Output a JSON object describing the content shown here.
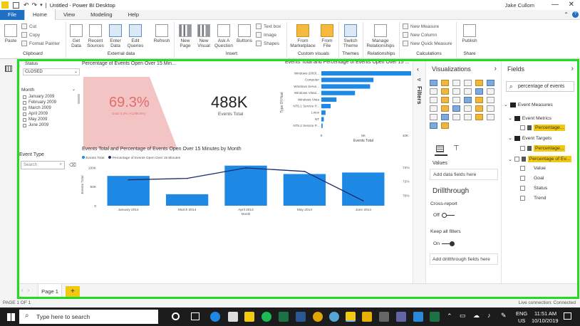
{
  "window": {
    "title": "Untitled - Power BI Desktop",
    "user": "Jake Cullom",
    "minimize": "—",
    "close": "✕"
  },
  "menu": {
    "file": "File",
    "tabs": [
      "Home",
      "View",
      "Modeling",
      "Help"
    ],
    "help_icon": "?"
  },
  "ribbon": {
    "cut": "Cut",
    "copy": "Copy",
    "format_painter": "Format Painter",
    "paste": "Paste",
    "get_data": "Get Data",
    "recent_sources": "Recent Sources",
    "enter_data": "Enter Data",
    "edit_queries": "Edit Queries",
    "refresh": "Refresh",
    "new_page": "New Page",
    "new_visual": "New Visual",
    "ask_a_question": "Ask A Question",
    "buttons": "Buttons",
    "text_box": "Text box",
    "image": "Image",
    "shapes": "Shapes",
    "from_marketplace": "From Marketplace",
    "from_file": "From File",
    "switch_theme": "Switch Theme",
    "manage_relationships": "Manage Relationships",
    "new_measure": "New Measure",
    "new_column": "New Column",
    "new_quick_measure": "New Quick Measure",
    "publish": "Publish",
    "groups": {
      "clipboard": "Clipboard",
      "external_data": "External data",
      "insert": "Insert",
      "custom_visuals": "Custom visuals",
      "themes": "Themes",
      "relationships": "Relationships",
      "calculations": "Calculations",
      "share": "Share"
    }
  },
  "report": {
    "status_slicer": {
      "label": "Status",
      "value": "CLOSED"
    },
    "month_slicer": {
      "label": "Month",
      "items": [
        "January 2009",
        "February 2009",
        "March 2009",
        "April 2009",
        "May 2009",
        "June 2009"
      ]
    },
    "event_type_slicer": {
      "label": "Event Type",
      "search_placeholder": "Search"
    },
    "gauge": {
      "title": "Percentage of Events Open Over 15 Min...",
      "value": "69.3%",
      "goal": "Goal: 5.0% (+1286.5%)",
      "fill": 0.693
    },
    "card": {
      "value": "488K",
      "label": "Events Total"
    },
    "bar_chart": {
      "title": "Events Total and Percentage of Events Open Over 15 ...",
      "ylabel": "Type Of Host",
      "xlabel": "Events Total",
      "xticks": [
        "0",
        "5K",
        "10K"
      ]
    },
    "combo_chart": {
      "title": "Events Total and Percentage of Events Open Over 15 Minutes by Month",
      "legend": [
        "Events Total",
        "Percentage of Events Open Over 15 Minutes"
      ],
      "ylabel": "Events Total",
      "xlabel": "Month",
      "yticks_left": [
        "100K",
        "50K",
        "0"
      ],
      "yticks_right": [
        "74%",
        "72%",
        "70%"
      ]
    }
  },
  "chart_data": [
    {
      "type": "bar",
      "title": "Events Total and Percentage of Events Open Over 15 ...",
      "ylabel": "Type Of Host",
      "xlabel": "Events Total",
      "categories": [
        "Windows 2003/...",
        "Computer",
        "Windows Serve...",
        "Windows Vista/...",
        "Windows Vista",
        "NT6.1 Service P...",
        "Linux",
        "NT",
        "NT5.2 Service P..."
      ],
      "values": [
        11200,
        6200,
        5800,
        4000,
        1800,
        1100,
        500,
        300,
        150
      ],
      "xlim": [
        0,
        10000
      ]
    },
    {
      "type": "bar",
      "title": "Events Total and Percentage of Events Open Over 15 Minutes by Month",
      "categories": [
        "January 2014",
        "March 2014",
        "April 2014",
        "May 2014",
        "June 2014"
      ],
      "series": [
        {
          "name": "Events Total",
          "values": [
            78000,
            30000,
            105000,
            83000,
            87000
          ]
        },
        {
          "name": "Percentage of Events Open Over 15 Minutes",
          "values": [
            72.2,
            72.4,
            73.9,
            73.4,
            69.2
          ]
        }
      ],
      "ylabel": "Events Total",
      "xlabel": "Month",
      "ylim": [
        0,
        110000
      ],
      "y2lim": [
        68.5,
        74.5
      ]
    }
  ],
  "filters_label": "Filters",
  "visualizations": {
    "title": "Visualizations",
    "values_label": "Values",
    "add_data_fields": "Add data fields here",
    "drillthrough": "Drillthrough",
    "cross_report": "Cross-report",
    "cross_report_state": "Off",
    "keep_all_filters": "Keep all filters",
    "keep_all_filters_state": "On",
    "add_drillthrough": "Add drillthrough fields here"
  },
  "fields": {
    "title": "Fields",
    "search_value": "percentage of events",
    "tables": [
      {
        "name": "Event Measures",
        "children": []
      },
      {
        "name": "Event Metrics",
        "children": [
          "Percentage..."
        ]
      },
      {
        "name": "Event Targets",
        "children": [
          "Percentage..."
        ]
      },
      {
        "name": "Percentage of Ev...",
        "children": [
          "Value",
          "Goal",
          "Status",
          "Trend"
        ]
      }
    ]
  },
  "pages": {
    "tab": "Page 1",
    "add": "+"
  },
  "status": {
    "page": "PAGE 1 OF 1",
    "live": "Live connection: Connected"
  },
  "taskbar": {
    "search_placeholder": "Type here to search",
    "lang": "ENG",
    "region": "US",
    "time": "11:51 AM",
    "date": "10/10/2019"
  },
  "colors": {
    "accent": "#1f6fc5",
    "bar": "#1e88e5",
    "line": "#1a2a6c",
    "gauge_fill": "#f3c4c4",
    "gauge_text": "#e36c6c",
    "highlight": "#21dc21",
    "field_highlight": "#f2c811"
  }
}
